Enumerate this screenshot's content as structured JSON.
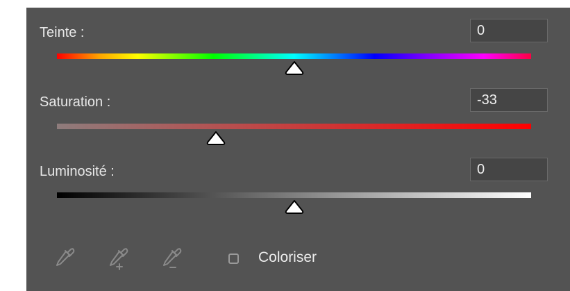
{
  "hue": {
    "label": "Teinte :",
    "value": "0",
    "level": 0.5
  },
  "saturation": {
    "label": "Saturation :",
    "value": "-33",
    "level": 0.335
  },
  "lightness": {
    "label": "Luminosité :",
    "value": "0",
    "level": 0.5
  },
  "tools": [
    "eyedropper-icon",
    "eyedropper-plus-icon",
    "eyedropper-minus-icon"
  ],
  "colorize": {
    "label": "Coloriser",
    "checked": false
  },
  "colors": {
    "panel": "#535353",
    "field": "#454545",
    "text": "#e8e8e8"
  }
}
